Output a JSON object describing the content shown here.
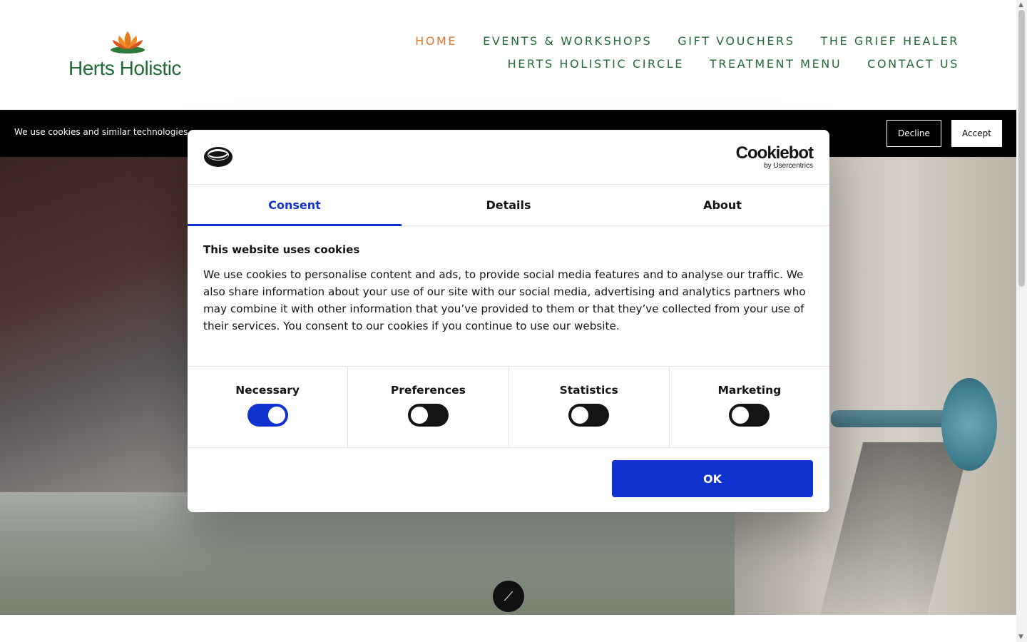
{
  "site": {
    "logo_text": "Herts Holistic"
  },
  "nav": {
    "row1": [
      "HOME",
      "EVENTS & WORKSHOPS",
      "GIFT VOUCHERS",
      "THE GRIEF HEALER"
    ],
    "row2": [
      "HERTS HOLISTIC CIRCLE",
      "TREATMENT MENU",
      "CONTACT US"
    ],
    "active": "HOME"
  },
  "cookie_bar": {
    "text": "We use cookies and similar technologies",
    "decline": "Decline",
    "accept": "Accept"
  },
  "dialog": {
    "brand_main": "Cookiebot",
    "brand_sub": "by Usercentrics",
    "tabs": [
      "Consent",
      "Details",
      "About"
    ],
    "active_tab": "Consent",
    "heading": "This website uses cookies",
    "body": "We use cookies to personalise content and ads, to provide social media features and to analyse our traffic. We also share information about your use of our site with our social media, advertising and analytics partners who may combine it with other information that you’ve provided to them or that they’ve collected from your use of their services. You consent to our cookies if you continue to use our website.",
    "toggles": [
      {
        "label": "Necessary",
        "on": true
      },
      {
        "label": "Preferences",
        "on": false
      },
      {
        "label": "Statistics",
        "on": false
      },
      {
        "label": "Marketing",
        "on": false
      }
    ],
    "ok": "OK"
  },
  "colors": {
    "brand_green": "#1f6b35",
    "nav_active": "#e0782a",
    "cookiebot_blue": "#1032cf"
  }
}
